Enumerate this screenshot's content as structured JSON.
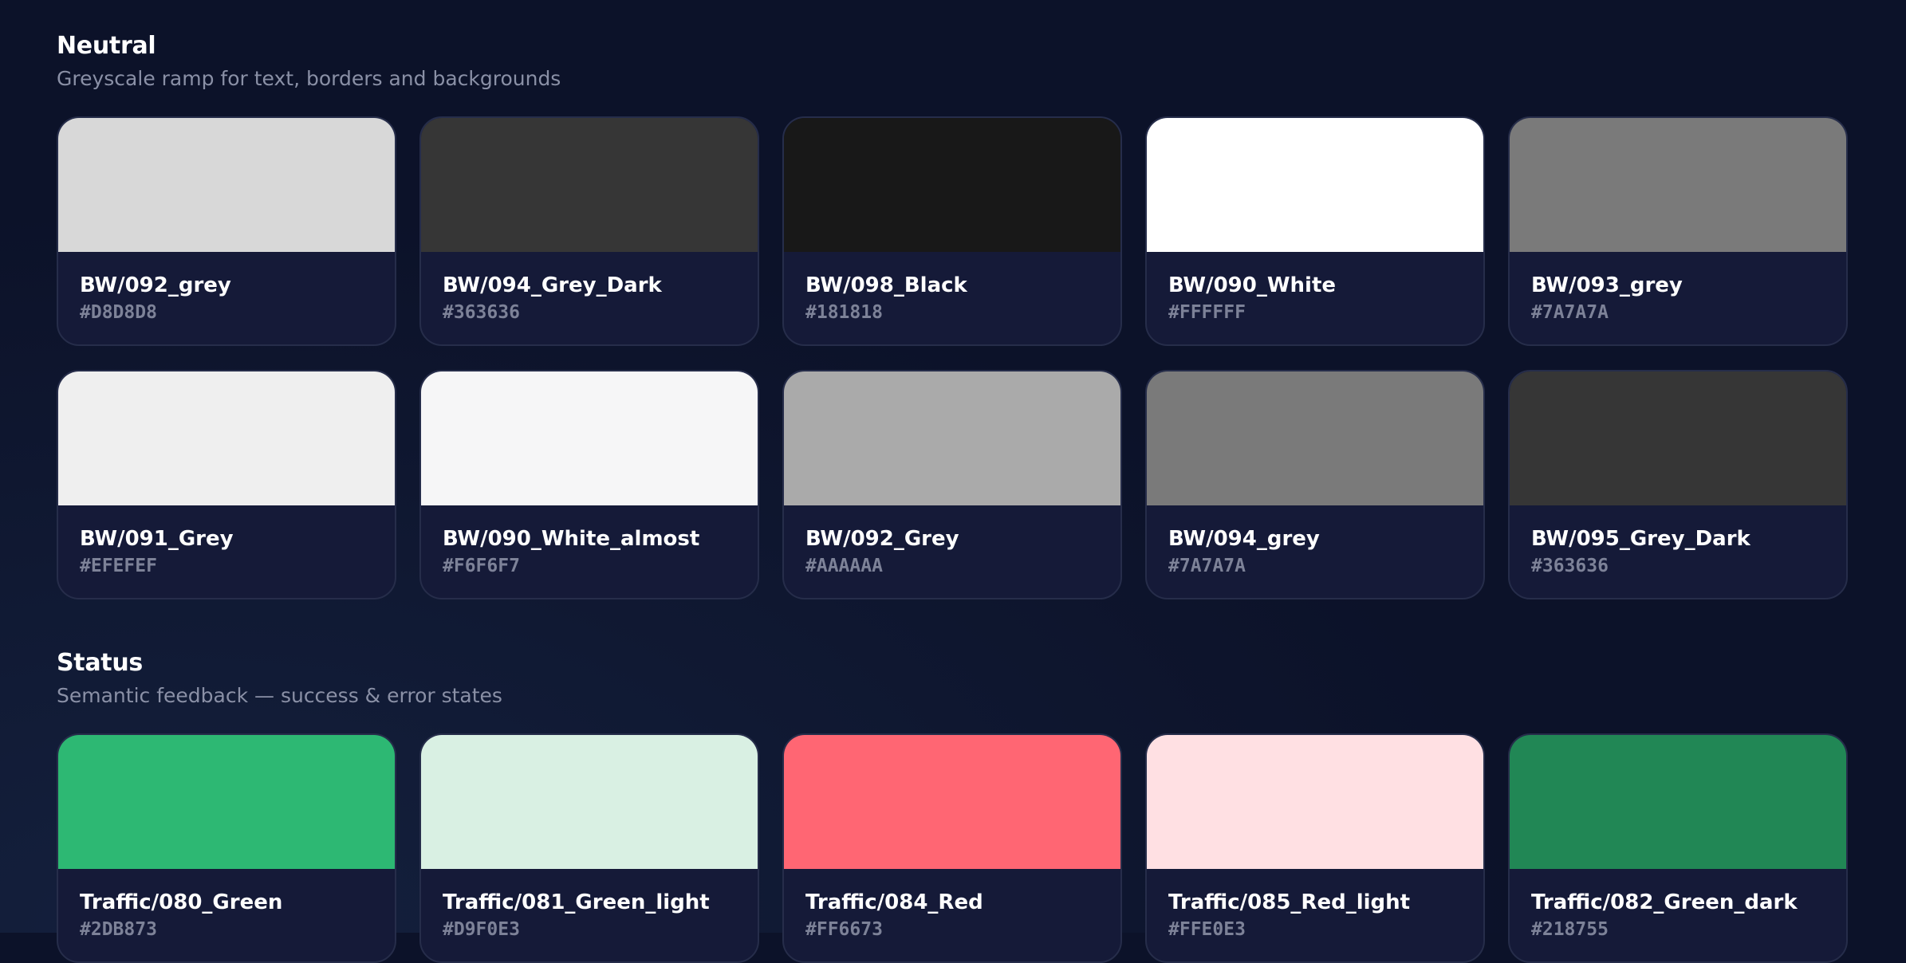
{
  "sections": [
    {
      "title": "Neutral",
      "subtitle": "Greyscale ramp for text, borders and backgrounds",
      "swatches": [
        {
          "name": "BW/092_grey",
          "hex": "#D8D8D8"
        },
        {
          "name": "BW/094_Grey_Dark",
          "hex": "#363636"
        },
        {
          "name": "BW/098_Black",
          "hex": "#181818"
        },
        {
          "name": "BW/090_White",
          "hex": "#FFFFFF"
        },
        {
          "name": "BW/093_grey",
          "hex": "#7A7A7A"
        },
        {
          "name": "BW/091_Grey",
          "hex": "#EFEFEF"
        },
        {
          "name": "BW/090_White_almost",
          "hex": "#F6F6F7"
        },
        {
          "name": "BW/092_Grey",
          "hex": "#AAAAAA"
        },
        {
          "name": "BW/094_grey",
          "hex": "#7A7A7A"
        },
        {
          "name": "BW/095_Grey_Dark",
          "hex": "#363636"
        }
      ]
    },
    {
      "title": "Status",
      "subtitle": "Semantic feedback — success & error states",
      "swatches": [
        {
          "name": "Traffic/080_Green",
          "hex": "#2DB873"
        },
        {
          "name": "Traffic/081_Green_light",
          "hex": "#D9F0E3"
        },
        {
          "name": "Traffic/084_Red",
          "hex": "#FF6673"
        },
        {
          "name": "Traffic/085_Red_light",
          "hex": "#FFE0E3"
        },
        {
          "name": "Traffic/082_Green_dark",
          "hex": "#218755"
        }
      ]
    }
  ]
}
